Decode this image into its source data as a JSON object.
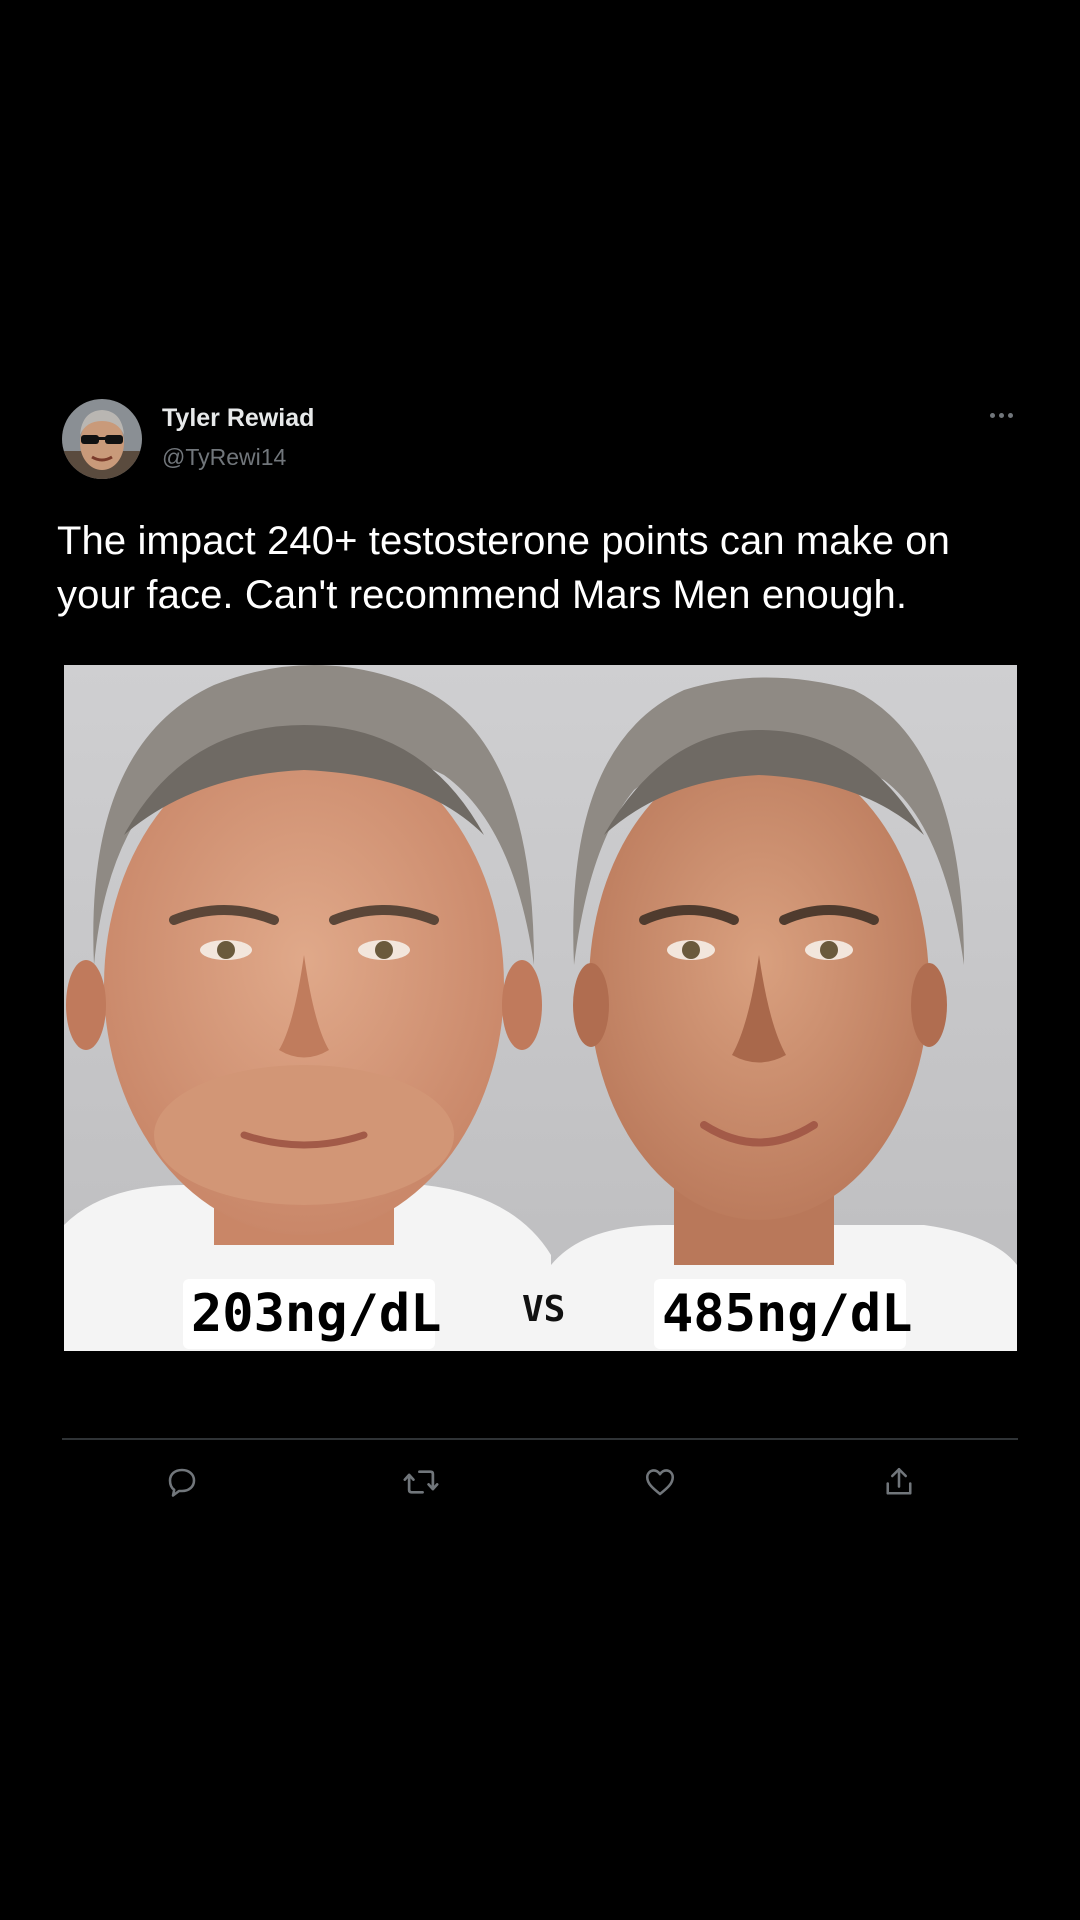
{
  "tweet": {
    "author": {
      "display_name": "Tyler Rewiad",
      "handle": "@TyRewi14",
      "avatar_icon": "profile-photo-man-sunglasses"
    },
    "more_icon": "more-horizontal-icon",
    "text": "The impact 240+ testosterone points can make on your face. Can't recommend Mars Men enough.",
    "media": {
      "left_label": "203ng/dL",
      "vs_label": "VS",
      "right_label": "485ng/dL"
    },
    "actions": [
      {
        "icon": "reply-icon"
      },
      {
        "icon": "retweet-icon"
      },
      {
        "icon": "like-heart-icon"
      },
      {
        "icon": "share-icon"
      }
    ]
  },
  "colors": {
    "background": "#000000",
    "text_primary": "#ffffff",
    "text_secondary": "#71767b",
    "divider": "#2f3336"
  }
}
